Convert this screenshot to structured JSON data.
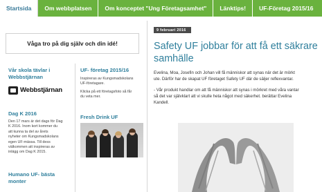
{
  "nav": {
    "items": [
      {
        "label": "Startsida",
        "active": true
      },
      {
        "label": "Om webbplatsen",
        "active": false
      },
      {
        "label": "Om konceptet \"Ung Företagsamhet\"",
        "active": false
      },
      {
        "label": "Länktips!",
        "active": false
      },
      {
        "label": "UF-Företag 2015/16",
        "active": false
      }
    ]
  },
  "banner": {
    "text": "Våga tro på dig själv och din idé!"
  },
  "left_column": {
    "school_title": "Vår skola tävlar i Webbstjärnan",
    "logo_text": "Webbstjärnan",
    "dagk_title": "Dag K 2016",
    "dagk_lines": [
      "Den 17 mars är det dags för Dag",
      "K 2016. Inom kort kommer du",
      "att kunna ta del av årets",
      "nyheter om Kungsmadskolans",
      "egen UF-mässa. Till dess",
      "välkommen att inspireras av",
      "inlägg om Dag K 2015."
    ],
    "humano_title": "Humano UF- bästa monter"
  },
  "middle_column": {
    "uf_title": "UF- företag 2015/16",
    "uf_lines": [
      "Inspireras av Kungsmadskolans",
      "UF-företagare."
    ],
    "uf_lines2": [
      "Klicka på ett företagsfoto så får",
      "du veta mer."
    ],
    "fresh_title": "Fresh Drink UF"
  },
  "article": {
    "date": "9 februari 2016",
    "title": "Safety UF jobbar för att få ett säkrare samhälle",
    "p1": [
      "Evelina, Moa, Josefin och Johan vill få människor att synas när det är mörkt",
      "ute. Därför har de skapat UF företaget Safety UF där de säljer reflexvantar."
    ],
    "p2": [
      "- Vår produkt handlar om att få människor att synas i mörkret med våra vantar",
      "så det var självklart att vi skulle heta något med säkerhet. berättar Evelina",
      "Kandell."
    ]
  },
  "colors": {
    "nav_green": "#6ab23e",
    "link_blue": "#2f7f9c",
    "date_bg": "#4a4a4a"
  },
  "icons": {
    "logo": "webbstjarnan-logo-icon"
  }
}
